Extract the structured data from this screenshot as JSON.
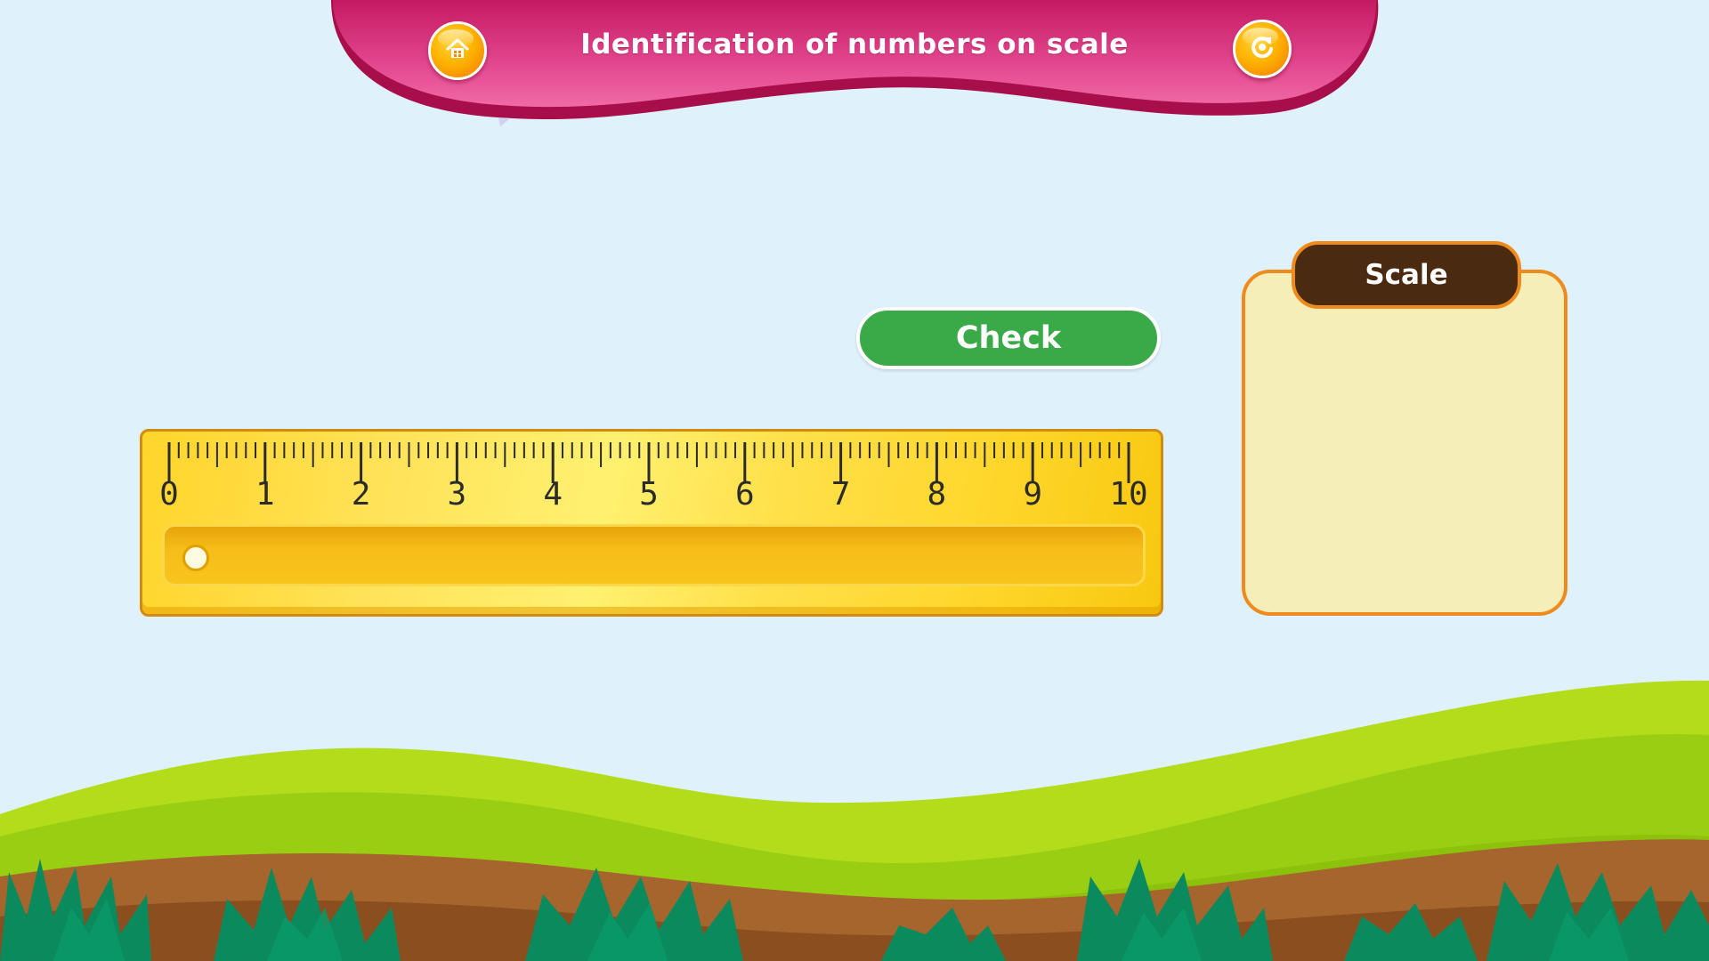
{
  "header": {
    "title": "Identification of numbers on scale",
    "home_icon": "home-icon",
    "replay_icon": "replay-icon"
  },
  "check_button": {
    "label": "Check"
  },
  "scale_panel": {
    "title": "Scale"
  },
  "ruler": {
    "labels": [
      "0",
      "1",
      "2",
      "3",
      "4",
      "5",
      "6",
      "7",
      "8",
      "9",
      "10"
    ],
    "minor_divisions": 10
  },
  "colors": {
    "banner": "#e0408a",
    "check_green": "#3aaa48",
    "panel_orange": "#ef8a1c",
    "tab_brown": "#4a2a10",
    "ruler_yellow": "#ffd52a"
  }
}
